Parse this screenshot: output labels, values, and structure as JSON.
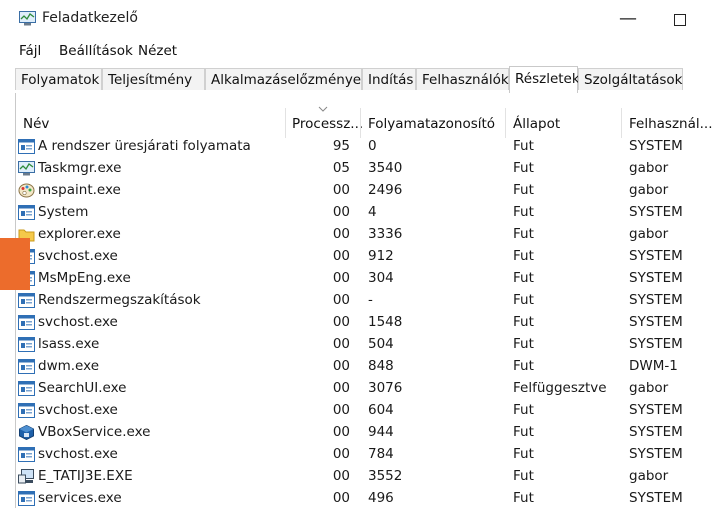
{
  "window": {
    "title": "Feladatkezelő",
    "minimize_glyph": "—"
  },
  "menu": [
    {
      "label": "Fájl"
    },
    {
      "label": "Beállítások"
    },
    {
      "label": "Nézet"
    }
  ],
  "tabs": [
    {
      "label": "Folyamatok",
      "active": false
    },
    {
      "label": "Teljesítmény",
      "active": false
    },
    {
      "label": "Alkalmazáselőzmények",
      "active": false
    },
    {
      "label": "Indítás",
      "active": false
    },
    {
      "label": "Felhasználók",
      "active": false
    },
    {
      "label": "Részletek",
      "active": true
    },
    {
      "label": "Szolgáltatások",
      "active": false
    }
  ],
  "columns": [
    {
      "label": "Név",
      "sort": "none"
    },
    {
      "label": "Processz...",
      "sort": "descending"
    },
    {
      "label": "Folyamatazonosító",
      "sort": "none"
    },
    {
      "label": "Állapot",
      "sort": "none"
    },
    {
      "label": "Felhasznál...",
      "sort": "none"
    }
  ],
  "rows": [
    {
      "icon": "window-icon",
      "name": "A rendszer üresjárati folyamata",
      "cpu": "95",
      "pid": "0",
      "state": "Fut",
      "user": "SYSTEM"
    },
    {
      "icon": "task-manager-icon",
      "name": "Taskmgr.exe",
      "cpu": "05",
      "pid": "3540",
      "state": "Fut",
      "user": "gabor"
    },
    {
      "icon": "paint-icon",
      "name": "mspaint.exe",
      "cpu": "00",
      "pid": "2496",
      "state": "Fut",
      "user": "gabor"
    },
    {
      "icon": "window-icon",
      "name": "System",
      "cpu": "00",
      "pid": "4",
      "state": "Fut",
      "user": "SYSTEM"
    },
    {
      "icon": "folder-icon",
      "name": "explorer.exe",
      "cpu": "00",
      "pid": "3336",
      "state": "Fut",
      "user": "gabor"
    },
    {
      "icon": "window-icon",
      "name": "svchost.exe",
      "cpu": "00",
      "pid": "912",
      "state": "Fut",
      "user": "SYSTEM"
    },
    {
      "icon": "window-icon",
      "name": "MsMpEng.exe",
      "cpu": "00",
      "pid": "304",
      "state": "Fut",
      "user": "SYSTEM"
    },
    {
      "icon": "window-icon",
      "name": "Rendszermegszakítások",
      "cpu": "00",
      "pid": "-",
      "state": "Fut",
      "user": "SYSTEM"
    },
    {
      "icon": "window-icon",
      "name": "svchost.exe",
      "cpu": "00",
      "pid": "1548",
      "state": "Fut",
      "user": "SYSTEM"
    },
    {
      "icon": "window-icon",
      "name": "lsass.exe",
      "cpu": "00",
      "pid": "504",
      "state": "Fut",
      "user": "SYSTEM"
    },
    {
      "icon": "window-icon",
      "name": "dwm.exe",
      "cpu": "00",
      "pid": "848",
      "state": "Fut",
      "user": "DWM-1"
    },
    {
      "icon": "window-icon",
      "name": "SearchUI.exe",
      "cpu": "00",
      "pid": "3076",
      "state": "Felfüggesztve",
      "user": "gabor"
    },
    {
      "icon": "window-icon",
      "name": "svchost.exe",
      "cpu": "00",
      "pid": "604",
      "state": "Fut",
      "user": "SYSTEM"
    },
    {
      "icon": "virtualbox-icon",
      "name": "VBoxService.exe",
      "cpu": "00",
      "pid": "944",
      "state": "Fut",
      "user": "SYSTEM"
    },
    {
      "icon": "window-icon",
      "name": "svchost.exe",
      "cpu": "00",
      "pid": "784",
      "state": "Fut",
      "user": "SYSTEM"
    },
    {
      "icon": "computer-icon",
      "name": "E_TATIJ3E.EXE",
      "cpu": "00",
      "pid": "3552",
      "state": "Fut",
      "user": "gabor"
    },
    {
      "icon": "window-icon",
      "name": "services.exe",
      "cpu": "00",
      "pid": "496",
      "state": "Fut",
      "user": "SYSTEM"
    }
  ],
  "colors": {
    "accent_marker": "#ec6c2c",
    "window_icon_blue": "#2f6fb5"
  }
}
